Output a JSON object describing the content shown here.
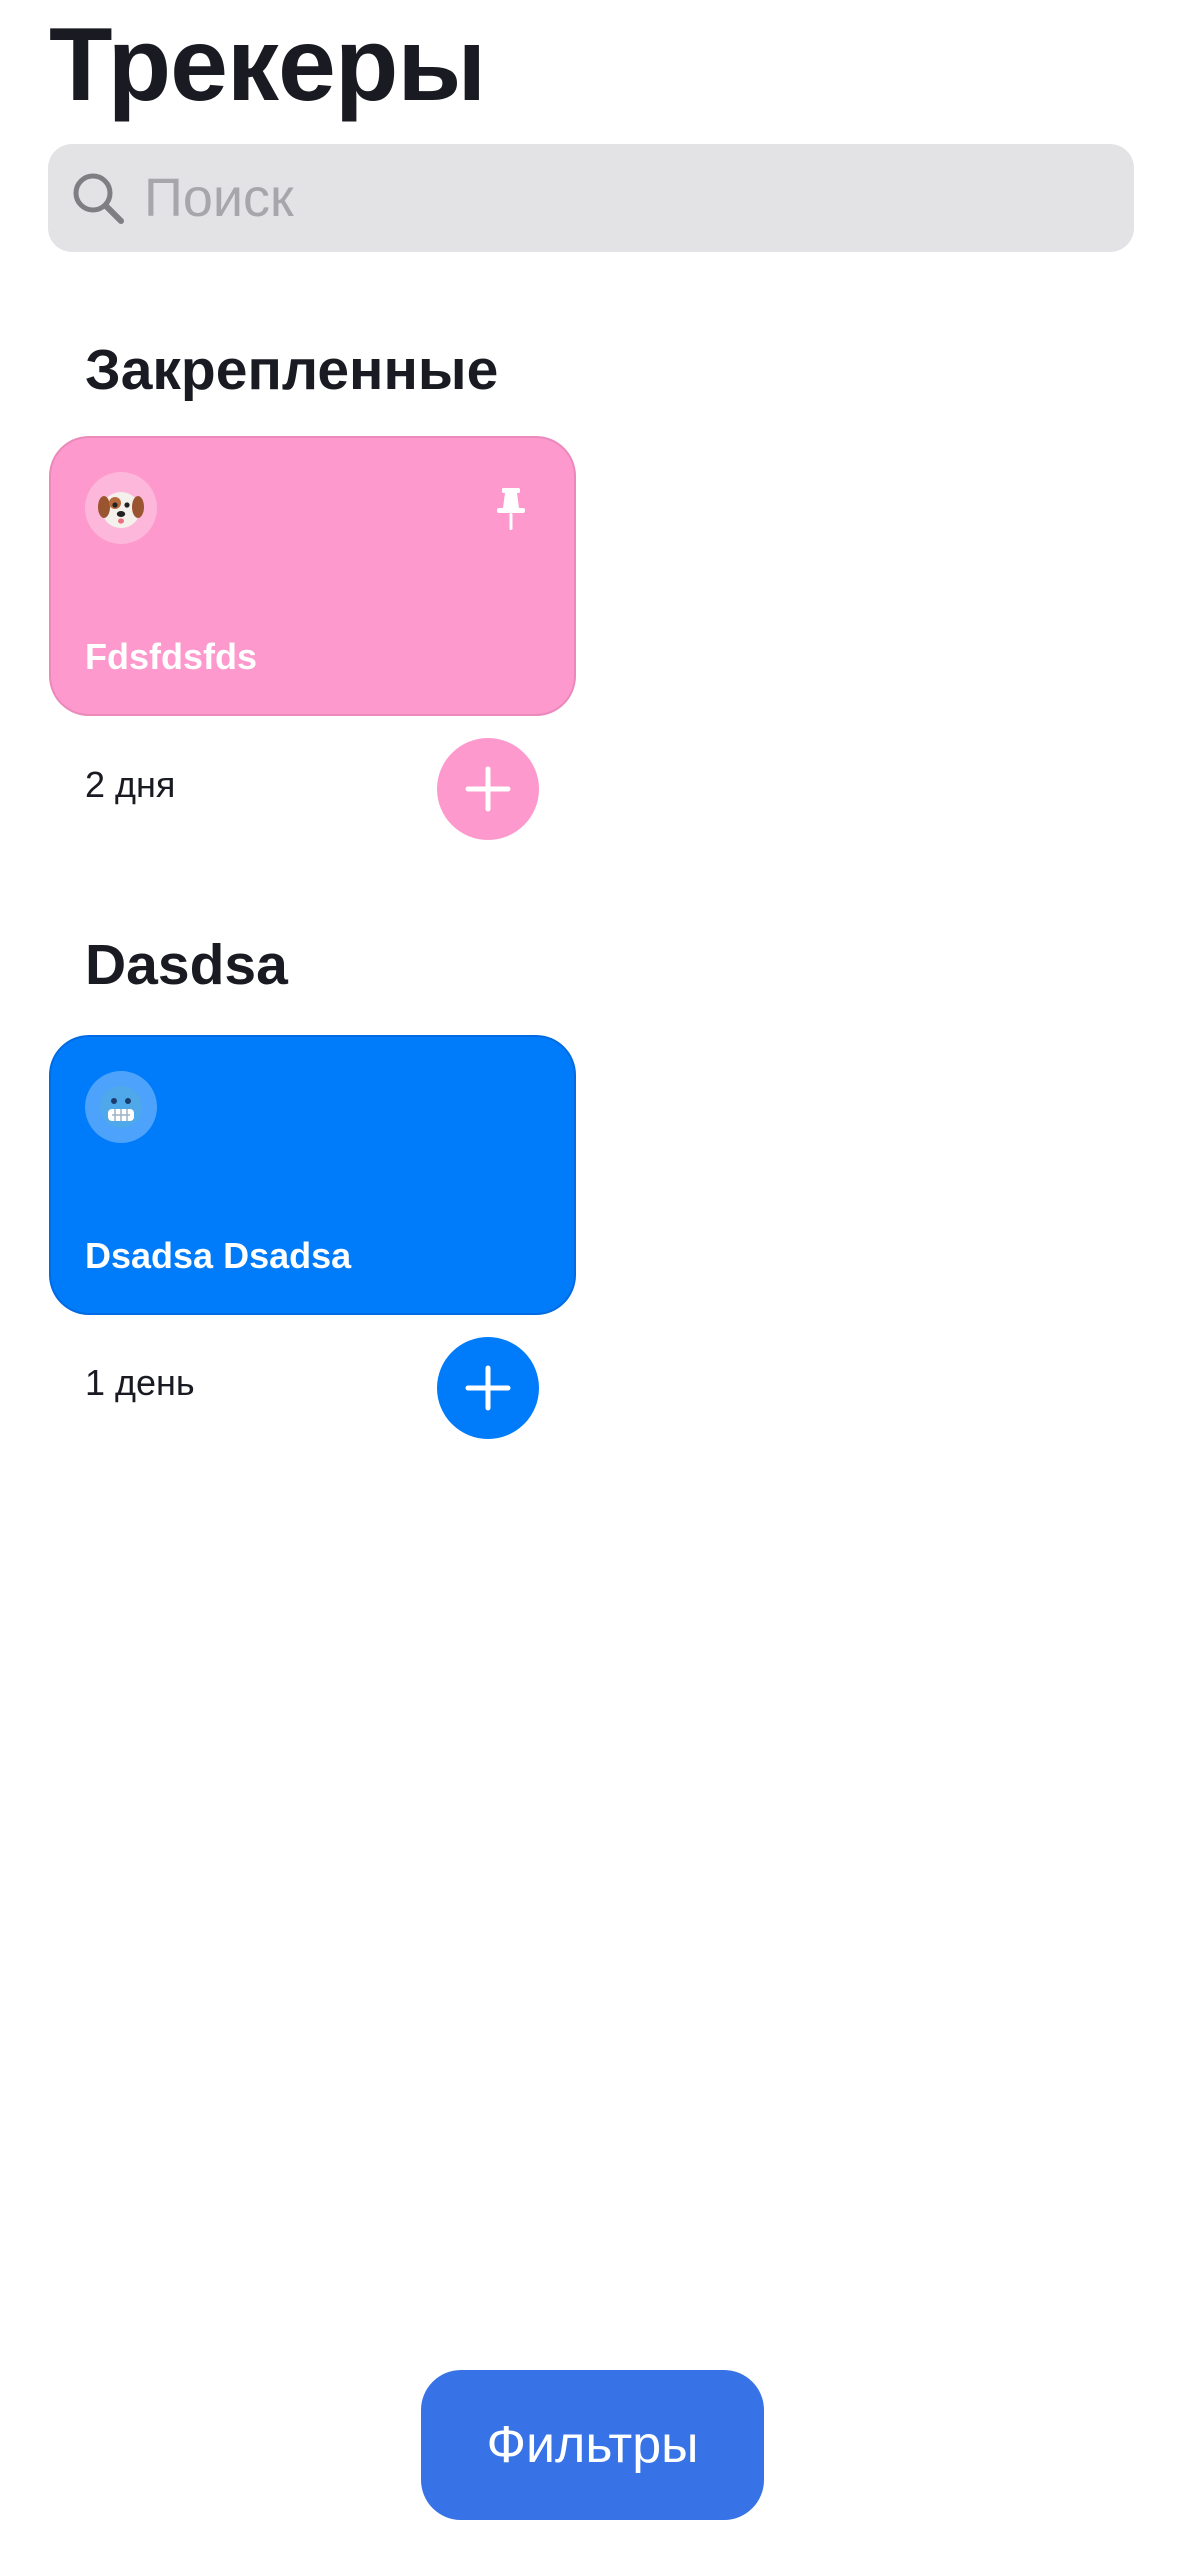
{
  "header": {
    "title": "Трекеры"
  },
  "search": {
    "placeholder": "Поиск",
    "value": ""
  },
  "sections": [
    {
      "title": "Закрепленные",
      "trackers": [
        {
          "name": "Fdsfdsfds",
          "emoji": "🐶",
          "color": "#FD99CC",
          "pinned": true,
          "count_label": "2 дня"
        }
      ]
    },
    {
      "title": "Dasdsa",
      "trackers": [
        {
          "name": "Dsadsa Dsadsa",
          "emoji": "🥶",
          "color": "#007BFA",
          "pinned": false,
          "count_label": "1 день"
        }
      ]
    }
  ],
  "filters": {
    "label": "Фильтры",
    "color": "#3772E7"
  },
  "icons": {
    "search": "search-icon",
    "pin": "pin-icon",
    "plus": "plus-icon"
  }
}
